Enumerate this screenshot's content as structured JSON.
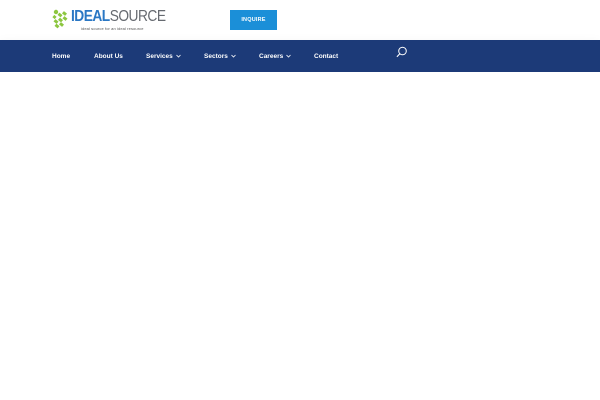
{
  "brand": {
    "name_part1": "IDEAL",
    "name_part2": "SOURCE",
    "tagline": "ideal source for an ideal resource",
    "colors": {
      "primary_blue": "#2a77c4",
      "green": "#8cc63f",
      "gray": "#666a70"
    }
  },
  "header": {
    "inquire_label": "INQUIRE",
    "inquire_color": "#1b8fd8"
  },
  "nav": {
    "background": "#1c3a78",
    "items": [
      {
        "label": "Home",
        "has_dropdown": false
      },
      {
        "label": "About Us",
        "has_dropdown": false
      },
      {
        "label": "Services",
        "has_dropdown": true
      },
      {
        "label": "Sectors",
        "has_dropdown": true
      },
      {
        "label": "Careers",
        "has_dropdown": true
      },
      {
        "label": "Contact",
        "has_dropdown": false
      }
    ],
    "search_icon": "search-icon",
    "dropdown_icon": "chevron-down-icon"
  }
}
